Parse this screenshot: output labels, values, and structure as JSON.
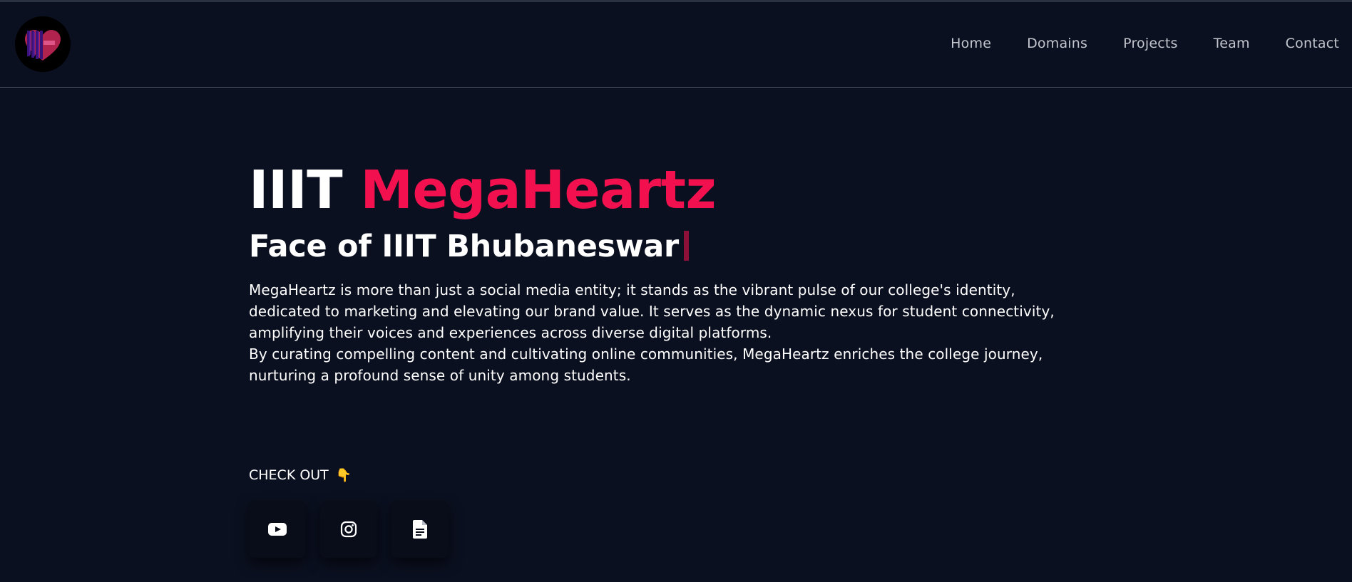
{
  "nav": {
    "links": [
      "Home",
      "Domains",
      "Projects",
      "Team",
      "Contact"
    ]
  },
  "hero": {
    "title_prefix": "IIIT",
    "title_brand": "MegaHeartz",
    "subtitle": "Face of IIIT Bhubaneswar",
    "description_p1": "MegaHeartz is more than just a social media entity; it stands as the vibrant pulse of our college's identity, dedicated to marketing and elevating our brand value. It serves as the dynamic nexus for student connectivity, amplifying their voices and experiences across diverse digital platforms.",
    "description_p2": "By curating compelling content and cultivating online communities, MegaHeartz enriches the college journey, nurturing a profound sense of unity among students."
  },
  "checkout": {
    "label": "CHECK OUT",
    "hand_icon": "👇"
  },
  "socials": [
    {
      "icon": "youtube-icon"
    },
    {
      "icon": "instagram-icon"
    },
    {
      "icon": "document-icon"
    }
  ],
  "colors": {
    "background": "#0b1020",
    "accent": "#f3104f",
    "nav_text": "#c3c6ce",
    "cursor": "#8c1038"
  }
}
